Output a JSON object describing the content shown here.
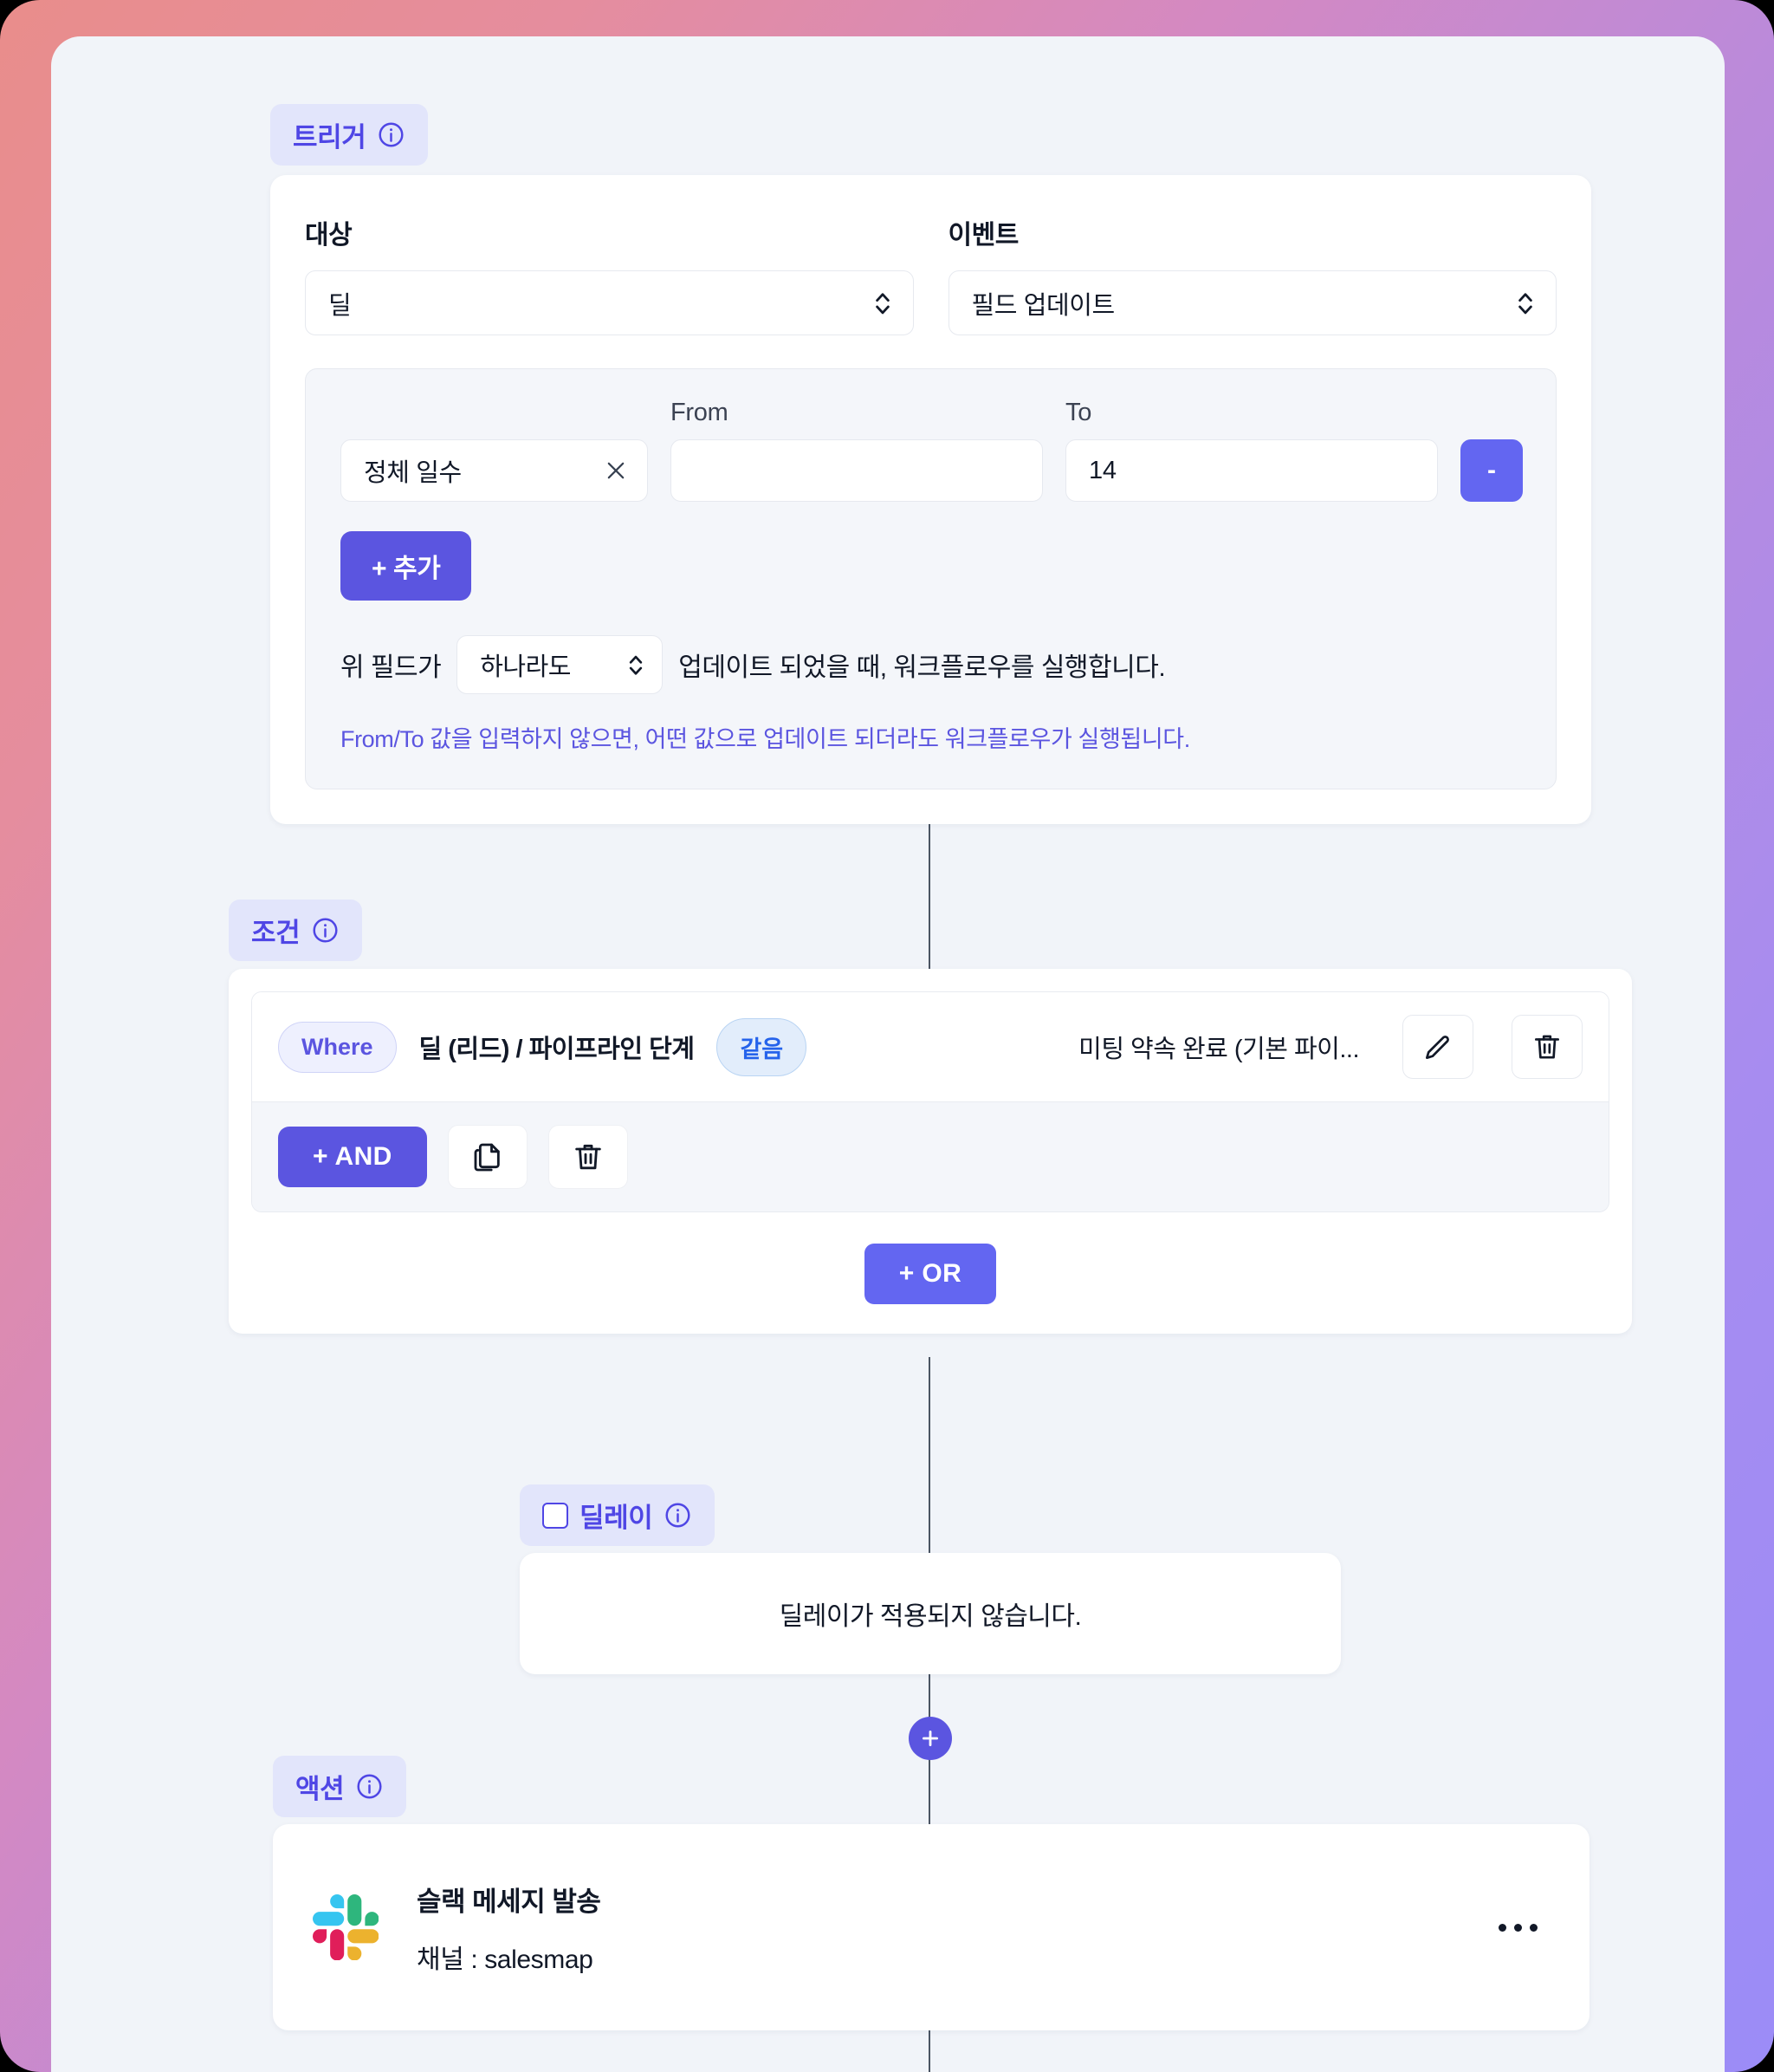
{
  "theme": {
    "accent": "#5b55e0",
    "accent_light": "#6366f1",
    "badge_bg": "#e2e5fb",
    "badge_text": "#4f46e5",
    "canvas_bg": "#f1f4f9",
    "card_bg": "#ffffff",
    "gradient_from": "#e98d8b",
    "gradient_to": "#9b8cf7"
  },
  "trigger": {
    "badge_label": "트리거",
    "target": {
      "label": "대상",
      "value": "딜"
    },
    "event": {
      "label": "이벤트",
      "value": "필드 업데이트"
    },
    "fromto": {
      "from_header": "From",
      "to_header": "To",
      "field_tag": "정체 일수",
      "from_value": "",
      "to_value": "14",
      "remove_label": "-",
      "add_label": "+ 추가"
    },
    "sentence": {
      "prefix": "위 필드가",
      "select_value": "하나라도",
      "suffix": "업데이트 되었을 때, 워크플로우를 실행합니다."
    },
    "note": "From/To 값을 입력하지 않으면, 어떤 값으로 업데이트 되더라도 워크플로우가 실행됩니다."
  },
  "condition": {
    "badge_label": "조건",
    "rows": [
      {
        "operator_pill": "Where",
        "field": "딜 (리드) / 파이프라인 단계",
        "comparator_pill": "같음",
        "value": "미팅 약속 완료 (기본 파이..."
      }
    ],
    "and_label": "+ AND",
    "or_label": "+ OR"
  },
  "delay": {
    "badge_label": "딜레이",
    "enabled": false,
    "message": "딜레이가 적용되지 않습니다."
  },
  "action": {
    "badge_label": "액션",
    "items": [
      {
        "title": "슬랙 메세지 발송",
        "subtitle": "채널 : salesmap",
        "logo": "slack-logo"
      }
    ]
  },
  "icons": {
    "info": "info-icon",
    "chevron_updown": "chevron-up-down-icon",
    "clear": "close-x-icon",
    "edit": "pencil-icon",
    "delete": "trash-icon",
    "duplicate": "copy-icon",
    "add_node": "plus-icon",
    "more": "more-horizontal-icon"
  }
}
